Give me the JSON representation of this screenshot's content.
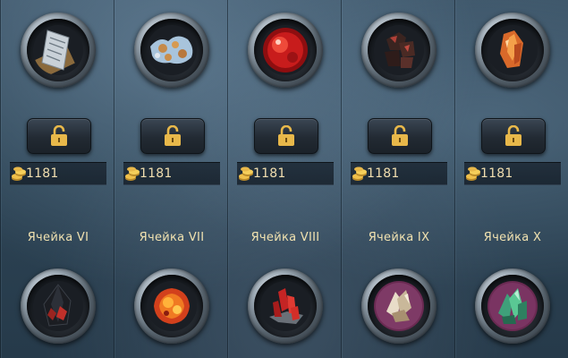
{
  "slots": [
    {
      "label": "Ячейка VI",
      "price": "1181",
      "top_item_icon": "scroll-icon",
      "bottom_item_icon": "black-crystal-icon"
    },
    {
      "label": "Ячейка VII",
      "price": "1181",
      "top_item_icon": "blue-ore-icon",
      "bottom_item_icon": "fire-amber-icon"
    },
    {
      "label": "Ячейка VIII",
      "price": "1181",
      "top_item_icon": "red-orb-icon",
      "bottom_item_icon": "red-crystal-icon"
    },
    {
      "label": "Ячейка IX",
      "price": "1181",
      "top_item_icon": "dark-ore-icon",
      "bottom_item_icon": "pink-crystal-icon"
    },
    {
      "label": "Ячейка X",
      "price": "1181",
      "top_item_icon": "orange-crystal-icon",
      "bottom_item_icon": "green-crystal-icon"
    }
  ],
  "colors": {
    "background": "#2d4455",
    "label_text": "#f1e2b0",
    "price_text": "#f2dfb0",
    "lock_gold": "#e8b84a"
  }
}
